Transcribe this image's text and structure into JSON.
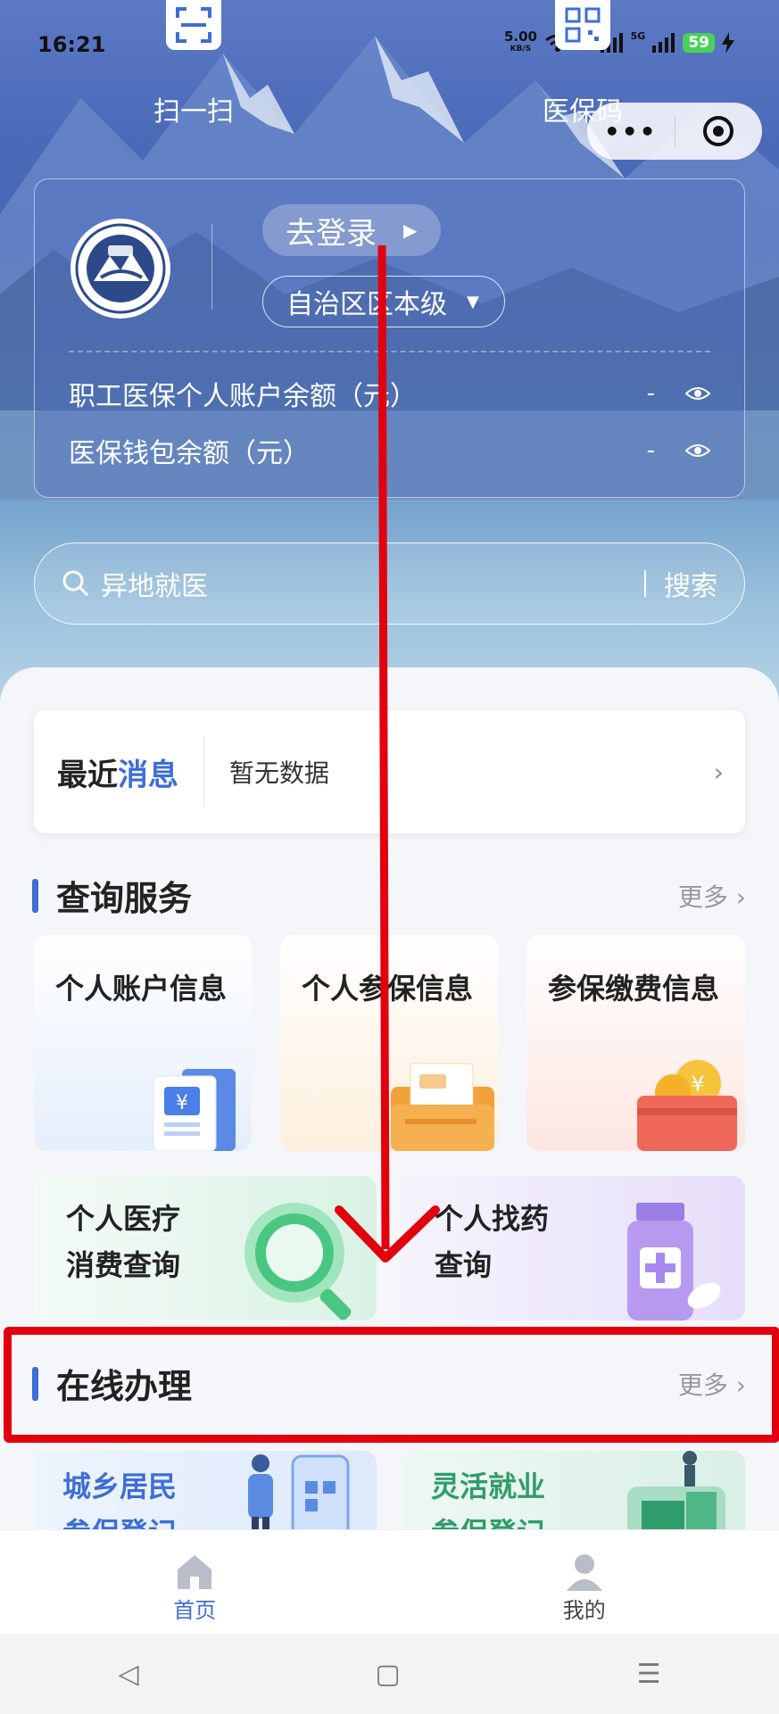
{
  "status_bar": {
    "time": "16:21",
    "speed_value": "5.00",
    "speed_unit": "KB/S",
    "sim1": "5G",
    "sim2": "5G",
    "battery": "59"
  },
  "top_actions": {
    "scan_label": "扫一扫",
    "code_label": "医保码"
  },
  "capsule": {
    "more": "•••"
  },
  "account_card": {
    "login_label": "去登录",
    "level_label": "自治区区本级",
    "rows": [
      {
        "label": "职工医保个人账户余额（元）",
        "value": "-"
      },
      {
        "label": "医保钱包余额（元）",
        "value": "-"
      }
    ]
  },
  "search": {
    "placeholder": "异地就医",
    "button": "搜索"
  },
  "messages": {
    "title_a": "最近",
    "title_b": "消息",
    "text": "暂无数据"
  },
  "query_section": {
    "title": "查询服务",
    "more": "更多",
    "tiles": [
      {
        "label": "个人账户信息"
      },
      {
        "label": "个人参保信息"
      },
      {
        "label": "参保缴费信息"
      }
    ],
    "wide_tiles": [
      {
        "line1": "个人医疗",
        "line2": "消费查询"
      },
      {
        "line1": "个人找药",
        "line2": "查询"
      }
    ]
  },
  "online_section": {
    "title": "在线办理",
    "more": "更多",
    "tiles": [
      {
        "line1": "城乡居民",
        "line2": "参保登记"
      },
      {
        "line1": "灵活就业",
        "line2": "参保登记"
      }
    ]
  },
  "tab_bar": {
    "home": "首页",
    "mine": "我的",
    "active_color": "#3e6ed6"
  },
  "annotation_color": "#e3000e"
}
